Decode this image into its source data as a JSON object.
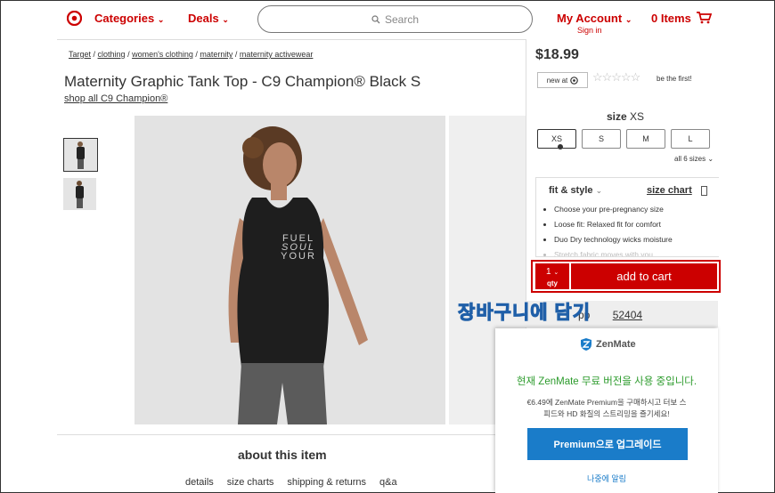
{
  "header": {
    "categories_label": "Categories",
    "deals_label": "Deals",
    "search_placeholder": "Search",
    "account_label": "My Account",
    "signin_label": "Sign in",
    "items_label": "0 Items"
  },
  "breadcrumb": [
    "Target",
    "clothing",
    "women's clothing",
    "maternity",
    "maternity activewear"
  ],
  "product": {
    "title": "Maternity Graphic Tank Top - C9 Champion® Black S",
    "shop_all": "shop all C9 Champion®",
    "shirt_text_1": "FUEL",
    "shirt_text_2": "SOUL",
    "shirt_text_3": "YOUR"
  },
  "buybox": {
    "price": "$18.99",
    "new_at": "new at",
    "be_first": "be the first!",
    "size_label": "size",
    "size_value": "XS",
    "sizes": [
      "XS",
      "S",
      "M",
      "L"
    ],
    "all_sizes": "all 6 sizes",
    "fit_style": "fit & style",
    "size_chart": "size chart",
    "fit_items": [
      "Choose your pre-pregnancy size",
      "Loose fit: Relaxed fit for comfort",
      "Duo Dry technology wicks moisture",
      "Stretch fabric moves with you"
    ],
    "qty_value": "1",
    "qty_label": "qty",
    "add_to_cart": "add to cart",
    "store_text": "pp",
    "store_number": "52404"
  },
  "overlay_caption": "장바구니에 담기",
  "popup": {
    "brand": "ZenMate",
    "headline": "현재 ZenMate 무료 버전을 사용 중입니다.",
    "body_line1": "€6.49에 ZenMate Premium을 구매하시고 터보 스",
    "body_line2": "피드와 HD 화질의 스트리밍을 즐기세요!",
    "upgrade_button": "Premium으로 업그레이드",
    "later_link": "나중에 알림",
    "accent": "#1a7cc9",
    "headline_color": "#2c9b2c"
  },
  "about": {
    "heading": "about this item",
    "tabs": [
      "details",
      "size charts",
      "shipping & returns",
      "q&a"
    ]
  },
  "colors": {
    "brand_red": "#cc0000"
  }
}
